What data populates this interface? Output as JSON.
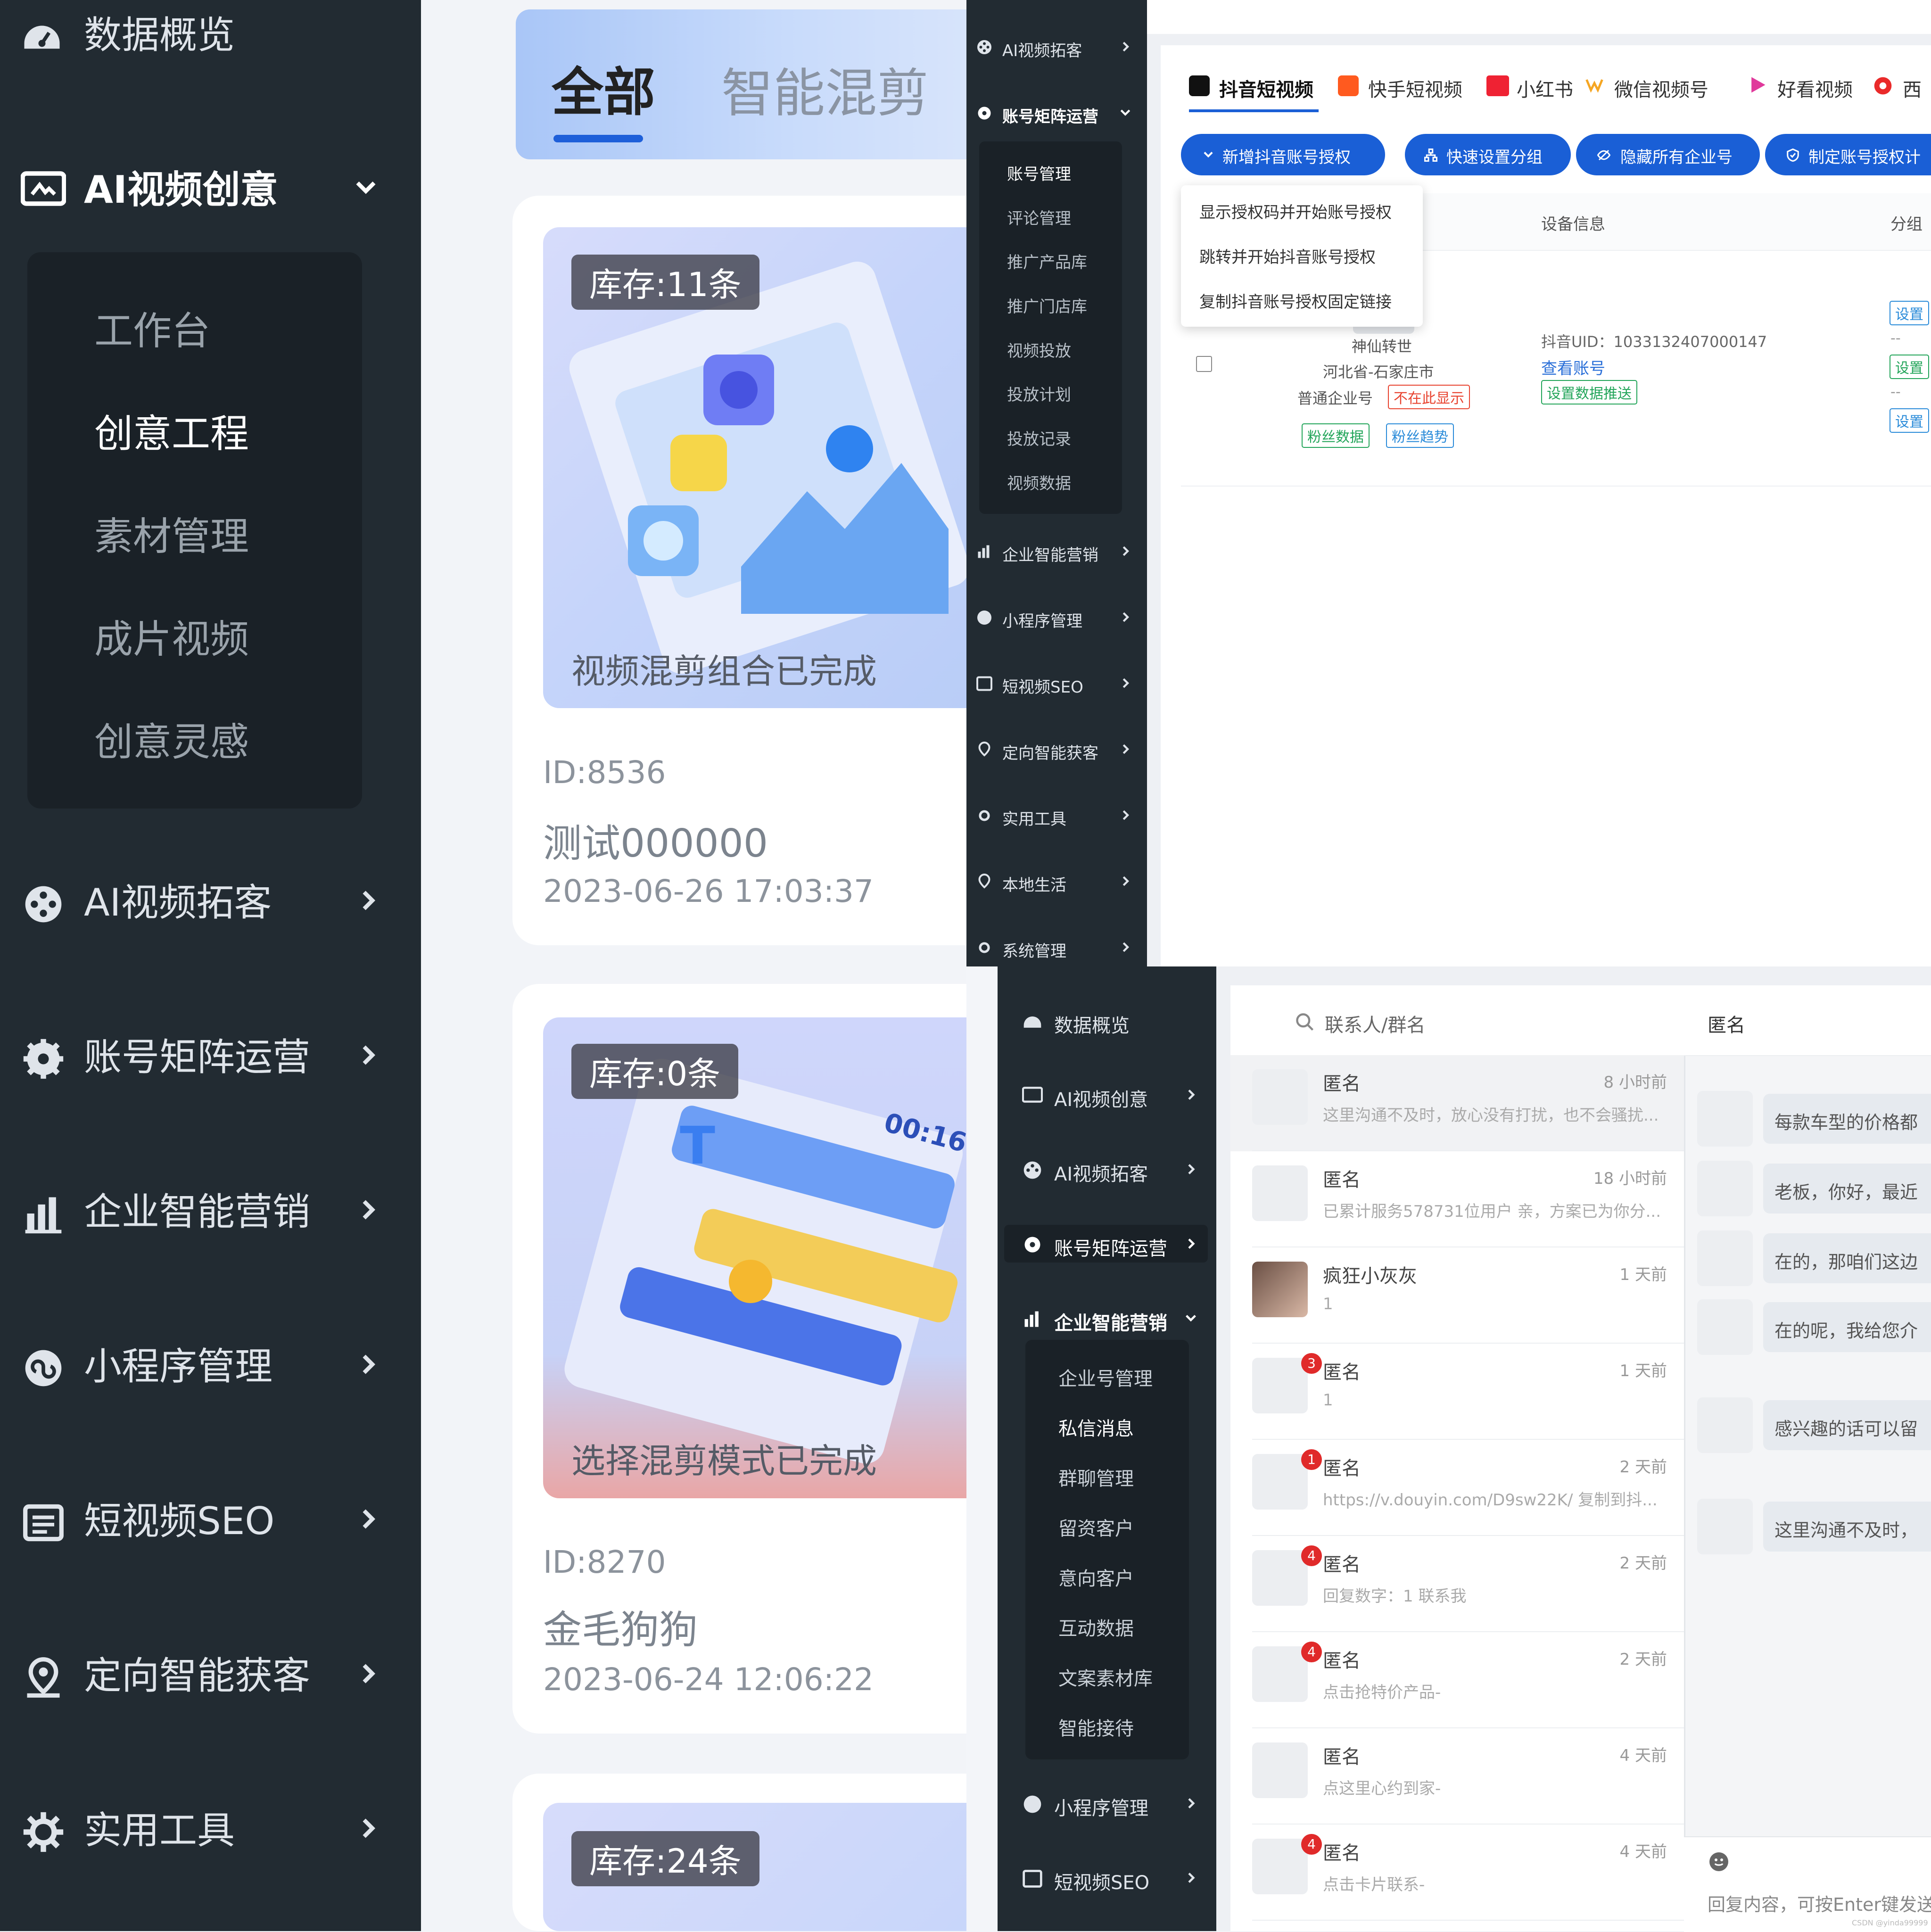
{
  "panel_a": {
    "sidebar": {
      "top_item": "数据概览",
      "expanded_group": "AI视频创意",
      "submenu": [
        "工作台",
        "创意工程",
        "素材管理",
        "成片视频",
        "创意灵感"
      ],
      "items": [
        "AI视频拓客",
        "账号矩阵运营",
        "企业智能营销",
        "小程序管理",
        "短视频SEO",
        "定向智能获客",
        "实用工具"
      ]
    },
    "tabs": [
      "全部",
      "智能混剪"
    ],
    "cards": [
      {
        "badge": "库存:11条",
        "caption": "视频混剪组合已完成",
        "id": "ID:8536",
        "name": "测试000000",
        "date": "2023-06-26 17:03:37"
      },
      {
        "badge": "库存:0条",
        "caption": "选择混剪模式已完成",
        "id": "ID:8270",
        "name": "金毛狗狗",
        "date": "2023-06-24 12:06:22"
      },
      {
        "badge": "库存:24条"
      }
    ]
  },
  "panel_b": {
    "sidebar": {
      "items_top": [
        "AI视频拓客",
        "账号矩阵运营"
      ],
      "submenu": [
        "账号管理",
        "评论管理",
        "推广产品库",
        "推广门店库",
        "视频投放",
        "投放计划",
        "投放记录",
        "视频数据"
      ],
      "items_bottom": [
        "企业智能营销",
        "小程序管理",
        "短视频SEO",
        "定向智能获客",
        "实用工具",
        "本地生活",
        "系统管理"
      ]
    },
    "platform_tabs": [
      "抖音短视频",
      "快手短视频",
      "小红书",
      "微信视频号",
      "好看视频",
      "西"
    ],
    "buttons": [
      "新增抖音账号授权",
      "快速设置分组",
      "隐藏所有企业号",
      "制定账号授权计"
    ],
    "dropdown": [
      "显示授权码并开始账号授权",
      "跳转并开始抖音账号授权",
      "复制抖音账号授权固定链接"
    ],
    "table_headers": [
      "设备信息",
      "分组"
    ],
    "row": {
      "name": "神仙转世",
      "region": "河北省-石家庄市",
      "type": "普通企业号",
      "status": "不在此显示",
      "tags": [
        "粉丝数据",
        "粉丝趋势"
      ],
      "uid": "抖音UID：1033132407000147",
      "view_link": "查看账号",
      "push_btn": "设置数据推送",
      "set_label": "设置",
      "dash": "--"
    }
  },
  "panel_c": {
    "sidebar": {
      "items_top": [
        "数据概览",
        "AI视频创意",
        "AI视频拓客",
        "账号矩阵运营",
        "企业智能营销"
      ],
      "submenu": [
        "企业号管理",
        "私信消息",
        "群聊管理",
        "留资客户",
        "意向客户",
        "互动数据",
        "文案素材库",
        "智能接待"
      ],
      "items_bottom": [
        "小程序管理",
        "短视频SEO"
      ]
    },
    "search_placeholder": "联系人/群名",
    "chat_title": "匿名",
    "conversations": [
      {
        "name": "匿名",
        "time": "8 小时前",
        "preview": "这里沟通不及时，放心没有打扰，也不会骚扰..."
      },
      {
        "name": "匿名",
        "time": "18 小时前",
        "preview": "已累计服务578731位用户 亲，方案已为你分..."
      },
      {
        "name": "疯狂小灰灰",
        "time": "1 天前",
        "preview": "1"
      },
      {
        "name": "匿名",
        "time": "1 天前",
        "preview": "1",
        "badge": "3"
      },
      {
        "name": "匿名",
        "time": "2 天前",
        "preview": "https://v.douyin.com/D9sw22K/ 复制到抖...",
        "badge": "1"
      },
      {
        "name": "匿名",
        "time": "2 天前",
        "preview": "回复数字：1 联系我",
        "badge": "4"
      },
      {
        "name": "匿名",
        "time": "2 天前",
        "preview": "点击抢特价产品-",
        "badge": "4"
      },
      {
        "name": "匿名",
        "time": "4 天前",
        "preview": "点这里心约到家-"
      },
      {
        "name": "匿名",
        "time": "4 天前",
        "preview": "点击卡片联系-",
        "badge": "4"
      }
    ],
    "messages": [
      "每款车型的价格都",
      "老板，你好，最近",
      "在的，那咱们这边",
      "在的呢，我给您介",
      "感兴趣的话可以留",
      "这里沟通不及时，"
    ],
    "reply_placeholder": "回复内容，可按Enter键发送",
    "watermark": "CSDN @yinda99999"
  },
  "colors": {
    "sidebar": "#222b32",
    "primary": "#1a5fd6",
    "danger": "#e02a2a"
  }
}
